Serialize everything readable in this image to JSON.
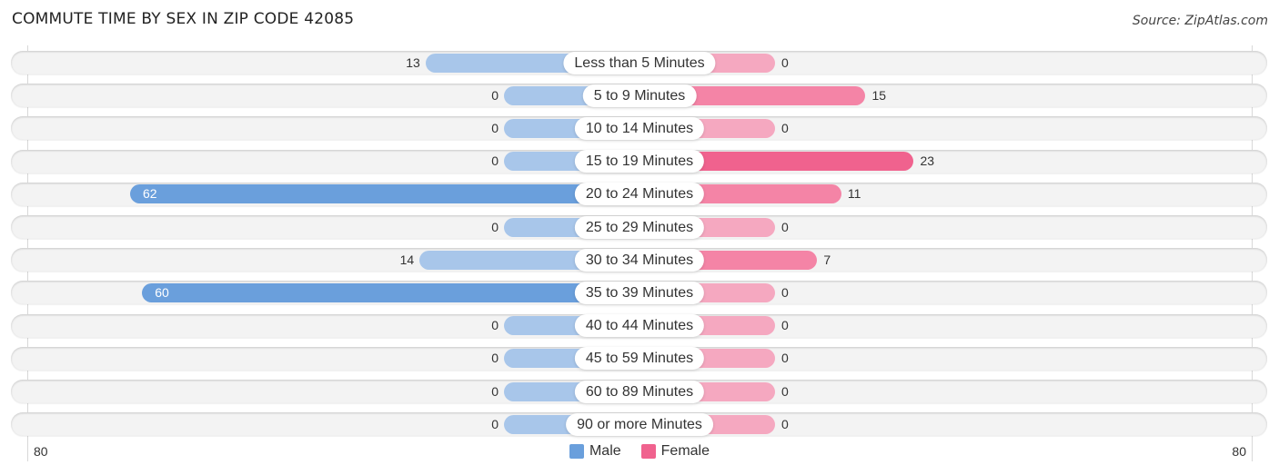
{
  "title": "COMMUTE TIME BY SEX IN ZIP CODE 42085",
  "source": "Source: ZipAtlas.com",
  "colors": {
    "male": "#6a9fdc",
    "male_light": "#a8c6ea",
    "female": "#f0628e",
    "female_light": "#f5a8c0"
  },
  "legend": {
    "male_label": "Male",
    "female_label": "Female"
  },
  "axis": {
    "left_tick": "80",
    "right_tick": "80"
  },
  "chart_data": {
    "type": "bar",
    "orientation": "horizontal-diverging",
    "title": "COMMUTE TIME BY SEX IN ZIP CODE 42085",
    "categories": [
      "Less than 5 Minutes",
      "5 to 9 Minutes",
      "10 to 14 Minutes",
      "15 to 19 Minutes",
      "20 to 24 Minutes",
      "25 to 29 Minutes",
      "30 to 34 Minutes",
      "35 to 39 Minutes",
      "40 to 44 Minutes",
      "45 to 59 Minutes",
      "60 to 89 Minutes",
      "90 or more Minutes"
    ],
    "series": [
      {
        "name": "Male",
        "values": [
          13,
          0,
          0,
          0,
          62,
          0,
          14,
          60,
          0,
          0,
          0,
          0
        ]
      },
      {
        "name": "Female",
        "values": [
          0,
          15,
          0,
          23,
          11,
          0,
          7,
          0,
          0,
          0,
          0,
          0
        ]
      }
    ],
    "xlim": [
      -80,
      80
    ],
    "xticks": [
      "80",
      "80"
    ],
    "legend_position": "bottom-center",
    "grid": false
  }
}
